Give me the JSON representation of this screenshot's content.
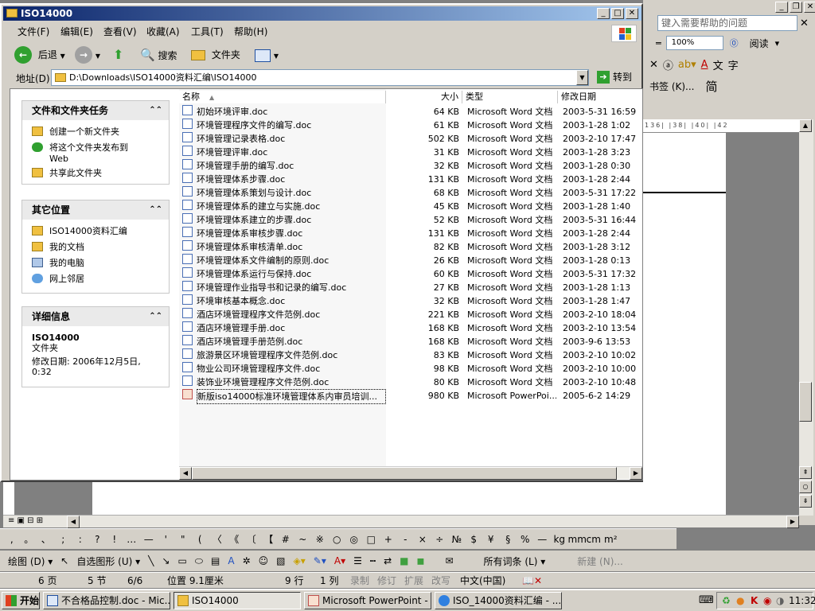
{
  "word": {
    "help_placeholder": "键入需要帮助的问题",
    "zoom": "100%",
    "read_btn": "阅读",
    "bookmark": "书签 (K)...",
    "simplified": "简",
    "ruler_ticks": "136| |38| |40| |42",
    "symbols": [
      ",",
      "。",
      "、",
      ";",
      ":",
      "?",
      "!",
      "…",
      "—",
      "'",
      "\"",
      "(",
      "〈",
      "《",
      "〔",
      "【",
      "#",
      "~",
      "※",
      "○",
      "◎",
      "□",
      "+",
      "-",
      "×",
      "÷",
      "№",
      "$",
      "¥",
      "§",
      "%",
      "—",
      "kg",
      "mm",
      "cm",
      "m²"
    ],
    "draw_label": "绘图 (D) ▾",
    "autoshape_label": "自选图形 (U) ▾",
    "all_entries": "所有词条 (L) ▾",
    "new_btn": "新建 (N)...",
    "status": {
      "page": "6 页",
      "section": "5 节",
      "pages": "6/6",
      "pos": "位置 9.1厘米",
      "line": "9 行",
      "col": "1 列",
      "rec": "录制",
      "trk": "修订",
      "ext": "扩展",
      "ovr": "改写",
      "lang": "中文(中国)"
    }
  },
  "explorer": {
    "title": "ISO14000",
    "menu": [
      "文件(F)",
      "编辑(E)",
      "查看(V)",
      "收藏(A)",
      "工具(T)",
      "帮助(H)"
    ],
    "toolbar": {
      "back": "后退",
      "search": "搜索",
      "folders": "文件夹"
    },
    "address_label": "地址(D)",
    "address": "D:\\Downloads\\ISO14000资料汇编\\ISO14000",
    "go": "转到",
    "tasks": {
      "header": "文件和文件夹任务",
      "items": [
        "创建一个新文件夹",
        "将这个文件夹发布到",
        "Web",
        "共享此文件夹"
      ]
    },
    "places": {
      "header": "其它位置",
      "items": [
        "ISO14000资料汇编",
        "我的文档",
        "我的电脑",
        "网上邻居"
      ]
    },
    "details": {
      "header": "详细信息",
      "name": "ISO14000",
      "kind": "文件夹",
      "modified": "修改日期: 2006年12月5日, 0:32"
    },
    "columns": {
      "name": "名称",
      "size": "大小",
      "type": "类型",
      "date": "修改日期"
    },
    "files": [
      {
        "name": "初始环境评审.doc",
        "size": "64 KB",
        "type": "Microsoft Word 文档",
        "date": "2003-5-31 16:59"
      },
      {
        "name": "环境管理程序文件的编写.doc",
        "size": "61 KB",
        "type": "Microsoft Word 文档",
        "date": "2003-1-28 1:02"
      },
      {
        "name": "环境管理记录表格.doc",
        "size": "502 KB",
        "type": "Microsoft Word 文档",
        "date": "2003-2-10 17:47"
      },
      {
        "name": "环境管理评审.doc",
        "size": "31 KB",
        "type": "Microsoft Word 文档",
        "date": "2003-1-28 3:23"
      },
      {
        "name": "环境管理手册的编写.doc",
        "size": "32 KB",
        "type": "Microsoft Word 文档",
        "date": "2003-1-28 0:30"
      },
      {
        "name": "环境管理体系步骤.doc",
        "size": "131 KB",
        "type": "Microsoft Word 文档",
        "date": "2003-1-28 2:44"
      },
      {
        "name": "环境管理体系策划与设计.doc",
        "size": "68 KB",
        "type": "Microsoft Word 文档",
        "date": "2003-5-31 17:22"
      },
      {
        "name": "环境管理体系的建立与实施.doc",
        "size": "45 KB",
        "type": "Microsoft Word 文档",
        "date": "2003-1-28 1:40"
      },
      {
        "name": "环境管理体系建立的步骤.doc",
        "size": "52 KB",
        "type": "Microsoft Word 文档",
        "date": "2003-5-31 16:44"
      },
      {
        "name": "环境管理体系审核步骤.doc",
        "size": "131 KB",
        "type": "Microsoft Word 文档",
        "date": "2003-1-28 2:44"
      },
      {
        "name": "环境管理体系审核清单.doc",
        "size": "82 KB",
        "type": "Microsoft Word 文档",
        "date": "2003-1-28 3:12"
      },
      {
        "name": "环境管理体系文件编制的原则.doc",
        "size": "26 KB",
        "type": "Microsoft Word 文档",
        "date": "2003-1-28 0:13"
      },
      {
        "name": "环境管理体系运行与保持.doc",
        "size": "60 KB",
        "type": "Microsoft Word 文档",
        "date": "2003-5-31 17:32"
      },
      {
        "name": "环境管理作业指导书和记录的编写.doc",
        "size": "27 KB",
        "type": "Microsoft Word 文档",
        "date": "2003-1-28 1:13"
      },
      {
        "name": "环境审核基本概念.doc",
        "size": "32 KB",
        "type": "Microsoft Word 文档",
        "date": "2003-1-28 1:47"
      },
      {
        "name": "酒店环境管理程序文件范例.doc",
        "size": "221 KB",
        "type": "Microsoft Word 文档",
        "date": "2003-2-10 18:04"
      },
      {
        "name": "酒店环境管理手册.doc",
        "size": "168 KB",
        "type": "Microsoft Word 文档",
        "date": "2003-2-10 13:54"
      },
      {
        "name": "酒店环境管理手册范例.doc",
        "size": "168 KB",
        "type": "Microsoft Word 文档",
        "date": "2003-9-6 13:53"
      },
      {
        "name": "旅游景区环境管理程序文件范例.doc",
        "size": "83 KB",
        "type": "Microsoft Word 文档",
        "date": "2003-2-10 10:02"
      },
      {
        "name": "物业公司环境管理程序文件.doc",
        "size": "98 KB",
        "type": "Microsoft Word 文档",
        "date": "2003-2-10 10:00"
      },
      {
        "name": "装饰业环境管理程序文件范例.doc",
        "size": "80 KB",
        "type": "Microsoft Word 文档",
        "date": "2003-2-10 10:48"
      },
      {
        "name": "新版iso14000标准环境管理体系内审员培训...",
        "size": "980 KB",
        "type": "Microsoft PowerPoi...",
        "date": "2005-6-2 14:29"
      }
    ]
  },
  "taskbar": {
    "start": "开始",
    "tasks": [
      "不合格品控制.doc - Mic...",
      "ISO14000",
      "Microsoft PowerPoint - [...",
      "ISO_14000资料汇编 - ..."
    ],
    "clock": "11:32"
  }
}
